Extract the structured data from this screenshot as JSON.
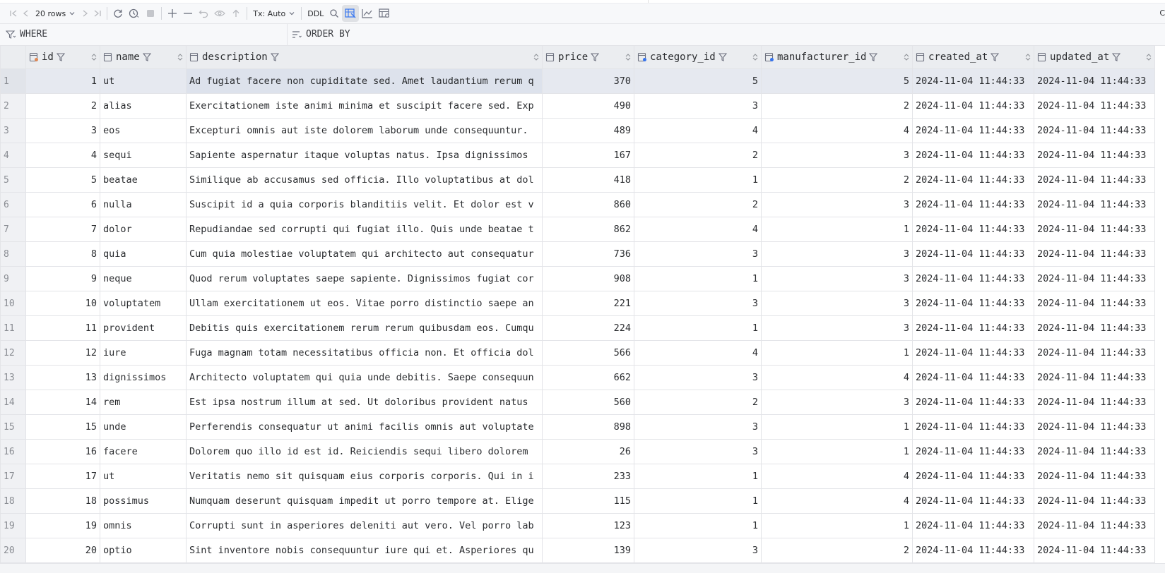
{
  "toolbar": {
    "rows_label": "20 rows",
    "tx_label": "Tx: Auto",
    "ddl_label": "DDL",
    "right_label": "C"
  },
  "filter": {
    "where_label": "WHERE",
    "orderby_label": "ORDER BY"
  },
  "columns": [
    "id",
    "name",
    "description",
    "price",
    "category_id",
    "manufacturer_id",
    "created_at",
    "updated_at"
  ],
  "rows": [
    {
      "n": "1",
      "id": "1",
      "name": "ut",
      "description": "Ad fugiat facere non cupiditate sed. Amet laudantium rerum q",
      "price": "370",
      "category_id": "5",
      "manufacturer_id": "5",
      "created_at": "2024-11-04 11:44:33",
      "updated_at": "2024-11-04 11:44:33"
    },
    {
      "n": "2",
      "id": "2",
      "name": "alias",
      "description": "Exercitationem iste animi minima et suscipit facere sed. Exp",
      "price": "490",
      "category_id": "3",
      "manufacturer_id": "2",
      "created_at": "2024-11-04 11:44:33",
      "updated_at": "2024-11-04 11:44:33"
    },
    {
      "n": "3",
      "id": "3",
      "name": "eos",
      "description": "Excepturi omnis aut iste dolorem laborum unde consequuntur. ",
      "price": "489",
      "category_id": "4",
      "manufacturer_id": "4",
      "created_at": "2024-11-04 11:44:33",
      "updated_at": "2024-11-04 11:44:33"
    },
    {
      "n": "4",
      "id": "4",
      "name": "sequi",
      "description": "Sapiente aspernatur itaque voluptas natus. Ipsa dignissimos ",
      "price": "167",
      "category_id": "2",
      "manufacturer_id": "3",
      "created_at": "2024-11-04 11:44:33",
      "updated_at": "2024-11-04 11:44:33"
    },
    {
      "n": "5",
      "id": "5",
      "name": "beatae",
      "description": "Similique ab accusamus sed officia. Illo voluptatibus at dol",
      "price": "418",
      "category_id": "1",
      "manufacturer_id": "2",
      "created_at": "2024-11-04 11:44:33",
      "updated_at": "2024-11-04 11:44:33"
    },
    {
      "n": "6",
      "id": "6",
      "name": "nulla",
      "description": "Suscipit id a quia corporis blanditiis velit. Et dolor est v",
      "price": "860",
      "category_id": "2",
      "manufacturer_id": "3",
      "created_at": "2024-11-04 11:44:33",
      "updated_at": "2024-11-04 11:44:33"
    },
    {
      "n": "7",
      "id": "7",
      "name": "dolor",
      "description": "Repudiandae sed corrupti qui fugiat illo. Quis unde beatae t",
      "price": "862",
      "category_id": "4",
      "manufacturer_id": "1",
      "created_at": "2024-11-04 11:44:33",
      "updated_at": "2024-11-04 11:44:33"
    },
    {
      "n": "8",
      "id": "8",
      "name": "quia",
      "description": "Cum quia molestiae voluptatem qui architecto aut consequatur",
      "price": "736",
      "category_id": "3",
      "manufacturer_id": "3",
      "created_at": "2024-11-04 11:44:33",
      "updated_at": "2024-11-04 11:44:33"
    },
    {
      "n": "9",
      "id": "9",
      "name": "neque",
      "description": "Quod rerum voluptates saepe sapiente. Dignissimos fugiat cor",
      "price": "908",
      "category_id": "1",
      "manufacturer_id": "3",
      "created_at": "2024-11-04 11:44:33",
      "updated_at": "2024-11-04 11:44:33"
    },
    {
      "n": "10",
      "id": "10",
      "name": "voluptatem",
      "description": "Ullam exercitationem ut eos. Vitae porro distinctio saepe an",
      "price": "221",
      "category_id": "3",
      "manufacturer_id": "3",
      "created_at": "2024-11-04 11:44:33",
      "updated_at": "2024-11-04 11:44:33"
    },
    {
      "n": "11",
      "id": "11",
      "name": "provident",
      "description": "Debitis quis exercitationem rerum rerum quibusdam eos. Cumqu",
      "price": "224",
      "category_id": "1",
      "manufacturer_id": "3",
      "created_at": "2024-11-04 11:44:33",
      "updated_at": "2024-11-04 11:44:33"
    },
    {
      "n": "12",
      "id": "12",
      "name": "iure",
      "description": "Fuga magnam totam necessitatibus officia non. Et officia dol",
      "price": "566",
      "category_id": "4",
      "manufacturer_id": "1",
      "created_at": "2024-11-04 11:44:33",
      "updated_at": "2024-11-04 11:44:33"
    },
    {
      "n": "13",
      "id": "13",
      "name": "dignissimos",
      "description": "Architecto voluptatem qui quia unde debitis. Saepe consequun",
      "price": "662",
      "category_id": "3",
      "manufacturer_id": "4",
      "created_at": "2024-11-04 11:44:33",
      "updated_at": "2024-11-04 11:44:33"
    },
    {
      "n": "14",
      "id": "14",
      "name": "rem",
      "description": "Est ipsa nostrum illum at sed. Ut doloribus provident natus ",
      "price": "560",
      "category_id": "2",
      "manufacturer_id": "3",
      "created_at": "2024-11-04 11:44:33",
      "updated_at": "2024-11-04 11:44:33"
    },
    {
      "n": "15",
      "id": "15",
      "name": "unde",
      "description": "Perferendis consequatur ut animi facilis omnis aut voluptate",
      "price": "898",
      "category_id": "3",
      "manufacturer_id": "1",
      "created_at": "2024-11-04 11:44:33",
      "updated_at": "2024-11-04 11:44:33"
    },
    {
      "n": "16",
      "id": "16",
      "name": "facere",
      "description": "Dolorem quo illo id est id. Reiciendis sequi libero dolorem ",
      "price": "26",
      "category_id": "3",
      "manufacturer_id": "1",
      "created_at": "2024-11-04 11:44:33",
      "updated_at": "2024-11-04 11:44:33"
    },
    {
      "n": "17",
      "id": "17",
      "name": "ut",
      "description": "Veritatis nemo sit quisquam eius corporis corporis. Qui in i",
      "price": "233",
      "category_id": "1",
      "manufacturer_id": "4",
      "created_at": "2024-11-04 11:44:33",
      "updated_at": "2024-11-04 11:44:33"
    },
    {
      "n": "18",
      "id": "18",
      "name": "possimus",
      "description": "Numquam deserunt quisquam impedit ut porro tempore at. Elige",
      "price": "115",
      "category_id": "1",
      "manufacturer_id": "4",
      "created_at": "2024-11-04 11:44:33",
      "updated_at": "2024-11-04 11:44:33"
    },
    {
      "n": "19",
      "id": "19",
      "name": "omnis",
      "description": "Corrupti sunt in asperiores deleniti aut vero. Vel porro lab",
      "price": "123",
      "category_id": "1",
      "manufacturer_id": "1",
      "created_at": "2024-11-04 11:44:33",
      "updated_at": "2024-11-04 11:44:33"
    },
    {
      "n": "20",
      "id": "20",
      "name": "optio",
      "description": "Sint inventore nobis consequuntur iure qui et. Asperiores qu",
      "price": "139",
      "category_id": "3",
      "manufacturer_id": "2",
      "created_at": "2024-11-04 11:44:33",
      "updated_at": "2024-11-04 11:44:33"
    }
  ],
  "icons": {
    "first-page": "first-page-icon",
    "prev-page": "prev-page-icon",
    "next-page": "next-page-icon",
    "last-page": "last-page-icon",
    "reload": "reload-icon",
    "history": "history-icon",
    "stop": "stop-icon",
    "add-row": "add-row-icon",
    "delete-row": "delete-row-icon",
    "revert": "revert-icon",
    "preview": "preview-icon",
    "submit": "submit-icon",
    "search": "search-icon",
    "view-mode": "view-mode-icon",
    "chart": "chart-icon",
    "grid-settings": "grid-settings-icon",
    "filter": "filter-icon",
    "sort": "sort-icon"
  },
  "colors": {
    "header_bg": "#ebedf0",
    "selected_row_bg": "#e6e9f0",
    "grid_line": "#e3e4e8",
    "row_number_text": "#8a8d93"
  }
}
